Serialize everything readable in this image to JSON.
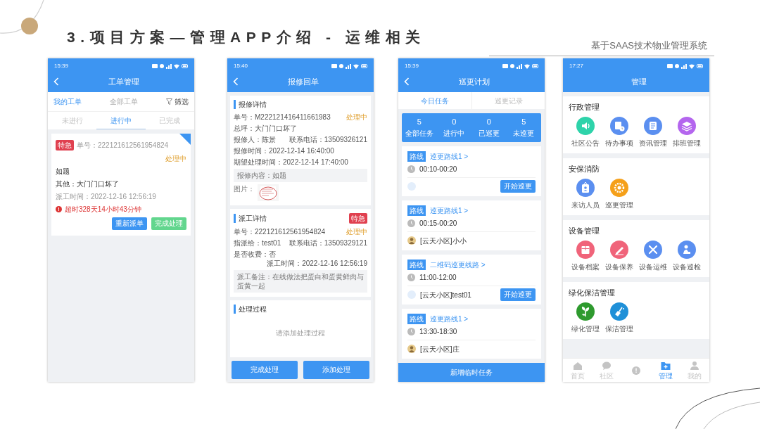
{
  "slide": {
    "title": "3.项目方案—管理APP介绍 - 运维相关",
    "subtitle": "基于SAAS技术物业管理系统"
  },
  "phones": [
    {
      "kind": "work_orders",
      "time": "15:39",
      "title": "工单管理",
      "tabs": [
        {
          "label": "我的工单",
          "selected": true
        },
        {
          "label": "全部工单",
          "selected": false
        }
      ],
      "filter": "筛选",
      "subtabs": [
        {
          "label": "未进行",
          "selected": false
        },
        {
          "label": "进行中",
          "selected": true
        },
        {
          "label": "已完成",
          "selected": false
        }
      ],
      "orders": [
        {
          "tag": "特急",
          "number": "单号：222121612561954824",
          "status": "处理中",
          "title": "如题",
          "description": "其他：大门门口坏了",
          "time": "派工时间：2022-12-16 12:56:19",
          "overdue": "超时328天14小时43分钟",
          "actions": [
            {
              "label": "重新派单",
              "color": "#3d95f2"
            },
            {
              "label": "完成处理",
              "color": "#62d68e"
            }
          ]
        }
      ]
    },
    {
      "kind": "repair_detail",
      "time": "15:40",
      "title": "报修回单",
      "sections": [
        {
          "heading": "报修详情",
          "lines": [
            {
              "kind": "line",
              "text": "单号：M222121416411661983",
              "status": "处理中"
            },
            {
              "kind": "line",
              "text": "总坪：大门门口坏了"
            },
            {
              "kind": "line",
              "text": "报修人：陈景",
              "aside": "联系电话：13509326121"
            },
            {
              "kind": "line",
              "text": "报修时间：2022-12-14 16:40:00"
            },
            {
              "kind": "line",
              "text": "期望处理时间：2022-12-14 17:40:00"
            },
            {
              "kind": "note",
              "text": "报修内容：如题"
            },
            {
              "text": "图片："
            }
          ]
        },
        {
          "heading": "派工详情",
          "tag": "特急",
          "lines": [
            {
              "kind": "line",
              "text": "单号：222121612561954824",
              "status": "处理中"
            },
            {
              "kind": "line",
              "text": "指派给：test01",
              "aside": "联系电话：13509329121"
            },
            {
              "kind": "line",
              "text": "是否收费：否",
              "aside": "派工时间：2022-12-16 12:56:19"
            },
            {
              "kind": "note",
              "text": "派工备注：在线做法把蛋白和蛋黄鲜肉与蛋黄一起"
            }
          ]
        },
        {
          "heading": "处理过程",
          "empty": "请添加处理过程"
        }
      ],
      "buttons": [
        "完成处理",
        "添加处理"
      ]
    },
    {
      "kind": "patrol_plan",
      "time": "15:39",
      "title": "巡更计划",
      "tabs": [
        {
          "label": "今日任务",
          "selected": true
        },
        {
          "label": "巡更记录",
          "selected": false
        }
      ],
      "stats": [
        {
          "value": "5",
          "label": "全部任务"
        },
        {
          "value": "0",
          "label": "进行中"
        },
        {
          "value": "0",
          "label": "已巡更"
        },
        {
          "value": "5",
          "label": "未巡更"
        }
      ],
      "tasks": [
        {
          "badge": "路线",
          "route": "巡更路线1 >",
          "time": "00:10-00:20",
          "avatar": {
            "kind": "blank"
          },
          "action": "开始巡更"
        },
        {
          "badge": "路线",
          "route": "巡更路线1 >",
          "time": "00:15-00:20",
          "person": "[云天小区]小小"
        },
        {
          "badge": "路线",
          "route": "二维码巡更线路 >",
          "time": "11:00-12:00",
          "avatar": {
            "kind": "blank"
          },
          "person": "[云天小区]test01",
          "action": "开始巡更"
        },
        {
          "badge": "路线",
          "route": "巡更路线1 >",
          "time": "13:30-18:30",
          "person": "[云天小区]庄"
        }
      ],
      "button": "新增临时任务"
    },
    {
      "kind": "management",
      "time": "17:27",
      "title": "管理",
      "groups": [
        {
          "heading": "行政管理",
          "items": [
            {
              "label": "社区公告",
              "color": "#2ed3aa"
            },
            {
              "label": "待办事项",
              "color": "#5b8ff0"
            },
            {
              "label": "资讯管理",
              "color": "#5b8ff0"
            },
            {
              "label": "排班管理",
              "color": "#b466ee"
            }
          ]
        },
        {
          "heading": "安保消防",
          "items": [
            {
              "label": "来访人员",
              "color": "#5b8ff0"
            },
            {
              "label": "巡更管理",
              "color": "#f5a01a"
            }
          ]
        },
        {
          "heading": "设备管理",
          "items": [
            {
              "label": "设备档案",
              "color": "#f0647a"
            },
            {
              "label": "设备保养",
              "color": "#f0647a"
            },
            {
              "label": "设备运维",
              "color": "#5b8ff0"
            },
            {
              "label": "设备巡检",
              "color": "#5b8ff0"
            }
          ]
        },
        {
          "heading": "绿化保洁管理",
          "items": [
            {
              "label": "绿化管理",
              "color": "#2e9a2e"
            },
            {
              "label": "保洁管理",
              "color": "#1f90d8"
            }
          ]
        }
      ],
      "tabbar": [
        {
          "label": "首页",
          "selected": false
        },
        {
          "label": "社区",
          "selected": false
        },
        {
          "selected": false
        },
        {
          "label": "管理",
          "selected": true
        },
        {
          "label": "我的",
          "selected": false
        }
      ]
    }
  ]
}
